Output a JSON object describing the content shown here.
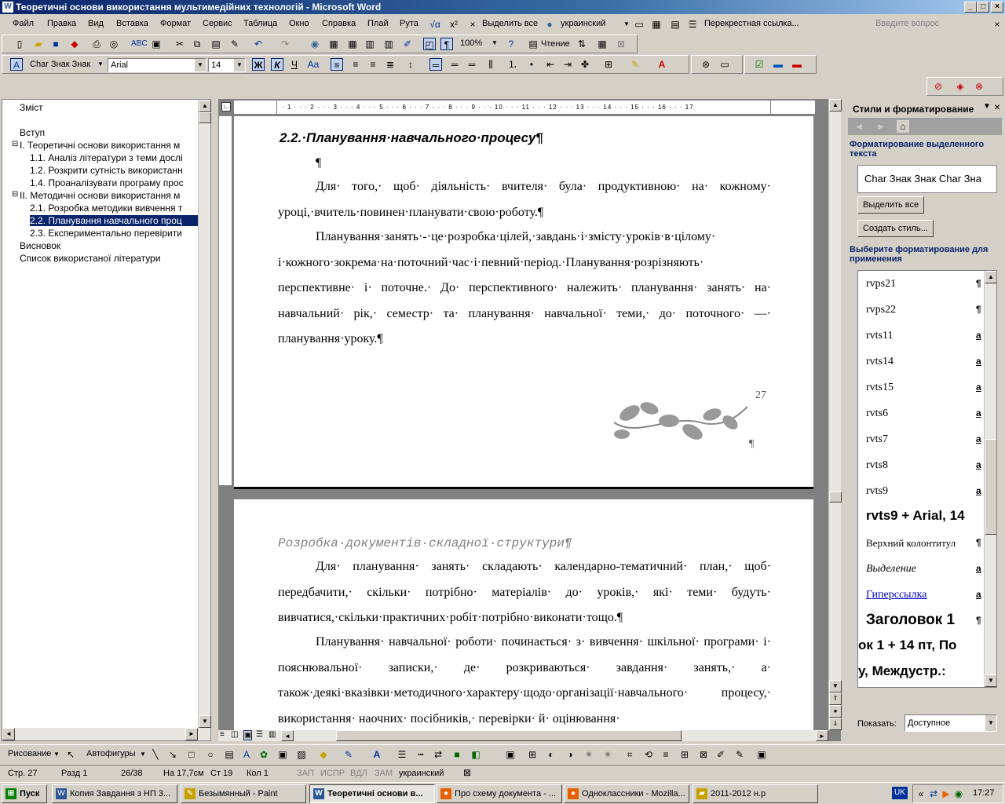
{
  "window": {
    "title": "Теоретичні основи використання мультимедійних технологій - Microsoft Word"
  },
  "menu": {
    "items": [
      "Файл",
      "Правка",
      "Вид",
      "Вставка",
      "Формат",
      "Сервис",
      "Таблица",
      "Окно",
      "Справка",
      "Плай",
      "Рута"
    ],
    "select_all": "Выделить все",
    "language": "украинский",
    "crossref": "Перекрестная ссылка...",
    "help_placeholder": "Введите вопрос"
  },
  "toolbar": {
    "zoom": "100%",
    "reading": "Чтение"
  },
  "format": {
    "style": "Char Знак Знак",
    "font": "Arial",
    "size": "14",
    "bold": "Ж",
    "italic": "К",
    "underline": "Ч"
  },
  "docmap": {
    "items": [
      {
        "label": "Зміст"
      },
      {
        "label": "Вступ"
      },
      {
        "label": "I. Теоретичні основи використання м"
      },
      {
        "label": "1.1. Аналіз літератури з теми дослі"
      },
      {
        "label": "1.2. Розкрити сутність використанн"
      },
      {
        "label": "1.4. Проаналізувати програму прос"
      },
      {
        "label": "II. Методичні основи використання м"
      },
      {
        "label": "2.1. Розробка методики вивчення т"
      },
      {
        "label": "2.2. Планування навчального проц"
      },
      {
        "label": "2.3. Експериментально перевірити"
      },
      {
        "label": "Висновок"
      },
      {
        "label": "Список використаної літератури"
      }
    ]
  },
  "document": {
    "page1": {
      "heading": "2.2.·Планування·навчального·процесу¶",
      "empty_para": "¶",
      "para1": "Для· того,· щоб· діяльність· вчителя· була· продуктивною· на· кожному· уроці,·вчитель·повинен·планувати·свою·роботу.¶",
      "para2": "Планування·занять·-·це·розробка·цілей,·завдань·і·змісту·уроків·в·цілому· і·кожного·зокрема·на·поточний·час·і·певний·період.·Планування·розрізняють· перспективне· і· поточне.· До· перспективного· належить· планування· занять· на· навчальний· рік,· семестр· та· планування· навчальної· теми,· до· поточного· —· планування·уроку.¶",
      "page_number": "27",
      "pilcrow": "¶"
    },
    "page2": {
      "header": "Розробка·документів·складної·структури¶",
      "para1": "Для· планування· занять· складають· календарно-тематичний· план,· щоб· передбачити,· скільки· потрібно· матеріалів· до· уроків,· які· теми· будуть· вивчатися,·скільки·практичних·робіт·потрібно·виконати·тощо.¶",
      "para2": "Планування· навчальної· роботи· починається· з· вивчення· шкільної· програми· і· пояснювальної· записки,· де· розкриваються· завдання· занять,· а· також·деякі·вказівки·методичного·характеру·щодо·організації·навчального· процесу,· використання· наочних· посібників,· перевірки· й· оцінювання·"
    }
  },
  "pane": {
    "title": "Стили и форматирование",
    "selected_label": "Форматирование выделенного текста",
    "current_style": "Char Знак Знак Char Зна",
    "select_all_btn": "Выделить все",
    "new_style_btn": "Создать стиль...",
    "apply_label": "Выберите форматирование для применения",
    "styles": [
      {
        "name": "rvps21",
        "mark": "¶"
      },
      {
        "name": "rvps22",
        "mark": "¶"
      },
      {
        "name": "rvts11",
        "mark": "a"
      },
      {
        "name": "rvts14",
        "mark": "a"
      },
      {
        "name": "rvts15",
        "mark": "a"
      },
      {
        "name": "rvts6",
        "mark": "a"
      },
      {
        "name": "rvts7",
        "mark": "a"
      },
      {
        "name": "rvts8",
        "mark": "a"
      },
      {
        "name": "rvts9",
        "mark": "a"
      },
      {
        "name": "rvts9 + Arial, 14",
        "mark": ""
      },
      {
        "name": "Верхний колонтитул",
        "mark": "¶"
      },
      {
        "name": "Выделение",
        "mark": "a"
      },
      {
        "name": "Гиперссылка",
        "mark": "a"
      },
      {
        "name": "Заголовок 1",
        "mark": "¶"
      },
      {
        "name": "ок 1 + 14 пт, По",
        "mark": ""
      },
      {
        "name": "у, Междустр.:",
        "mark": ""
      }
    ],
    "show_label": "Показать:",
    "show_value": "Доступное"
  },
  "drawbar": {
    "draw": "Рисование",
    "autoshapes": "Автофигуры"
  },
  "status": {
    "page": "Стр. 27",
    "section": "Разд 1",
    "pages": "26/38",
    "at": "На 17,7см",
    "line": "Ст 19",
    "col": "Кол 1",
    "rec": "ЗАП",
    "trk": "ИСПР",
    "ext": "ВДЛ",
    "ovr": "ЗАМ",
    "lang": "украинский"
  },
  "taskbar": {
    "start": "Пуск",
    "tasks": [
      {
        "label": "Копия Завдання з НП 3..."
      },
      {
        "label": "Безымянный - Paint"
      },
      {
        "label": "Теоретичні основи в..."
      },
      {
        "label": "Про схему документа - ..."
      },
      {
        "label": "Одноклассники - Mozilla..."
      },
      {
        "label": "2011-2012 н.р"
      }
    ],
    "lang": "UK",
    "clock": "17:27"
  }
}
